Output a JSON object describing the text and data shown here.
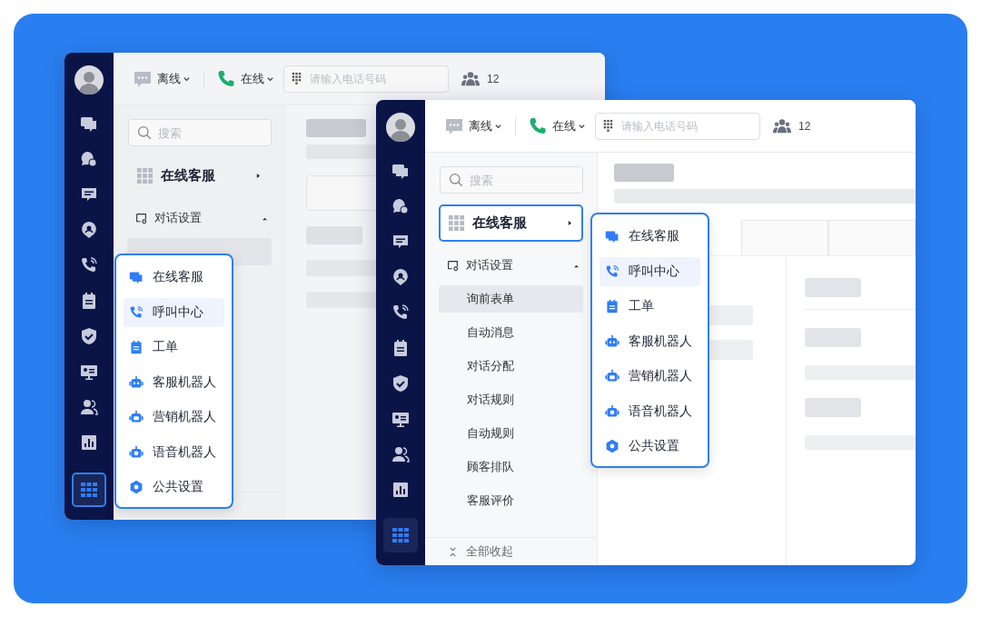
{
  "windows": [
    {
      "kind": "back",
      "apps_button_focused": true,
      "toolbar": {
        "offline_label": "离线",
        "online_label": "在线",
        "phone_field": {
          "placeholder": "请输入电话号码"
        },
        "team_count": "12"
      },
      "search": {
        "placeholder": "搜索"
      },
      "section": {
        "label": "在线客服",
        "focused": false
      },
      "group": {
        "label": "对话设置",
        "expanded": true
      },
      "app_menu": {
        "items": [
          {
            "label": "在线客服",
            "selected": false
          },
          {
            "label": "呼叫中心",
            "selected": true
          },
          {
            "label": "工单",
            "selected": false
          },
          {
            "label": "客服机器人",
            "selected": false
          },
          {
            "label": "营销机器人",
            "selected": false
          },
          {
            "label": "语音机器人",
            "selected": false
          },
          {
            "label": "公共设置",
            "selected": false
          }
        ]
      }
    },
    {
      "kind": "front",
      "apps_button_focused": false,
      "toolbar": {
        "offline_label": "离线",
        "online_label": "在线",
        "phone_field": {
          "placeholder": "请输入电话号码"
        },
        "team_count": "12"
      },
      "search": {
        "placeholder": "搜索"
      },
      "section": {
        "label": "在线客服",
        "focused": true
      },
      "group": {
        "label": "对话设置",
        "expanded": true,
        "items": [
          {
            "label": "询前表单",
            "selected": true
          },
          {
            "label": "自动消息",
            "selected": false
          },
          {
            "label": "对话分配",
            "selected": false
          },
          {
            "label": "对话规则",
            "selected": false
          },
          {
            "label": "自动规则",
            "selected": false
          },
          {
            "label": "顾客排队",
            "selected": false
          },
          {
            "label": "客服评价",
            "selected": false
          }
        ]
      },
      "collapse_label": "全部收起",
      "app_menu": {
        "items": [
          {
            "label": "在线客服",
            "selected": false
          },
          {
            "label": "呼叫中心",
            "selected": true
          },
          {
            "label": "工单",
            "selected": false
          },
          {
            "label": "客服机器人",
            "selected": false
          },
          {
            "label": "营销机器人",
            "selected": false
          },
          {
            "label": "语音机器人",
            "selected": false
          },
          {
            "label": "公共设置",
            "selected": false
          }
        ]
      }
    }
  ]
}
